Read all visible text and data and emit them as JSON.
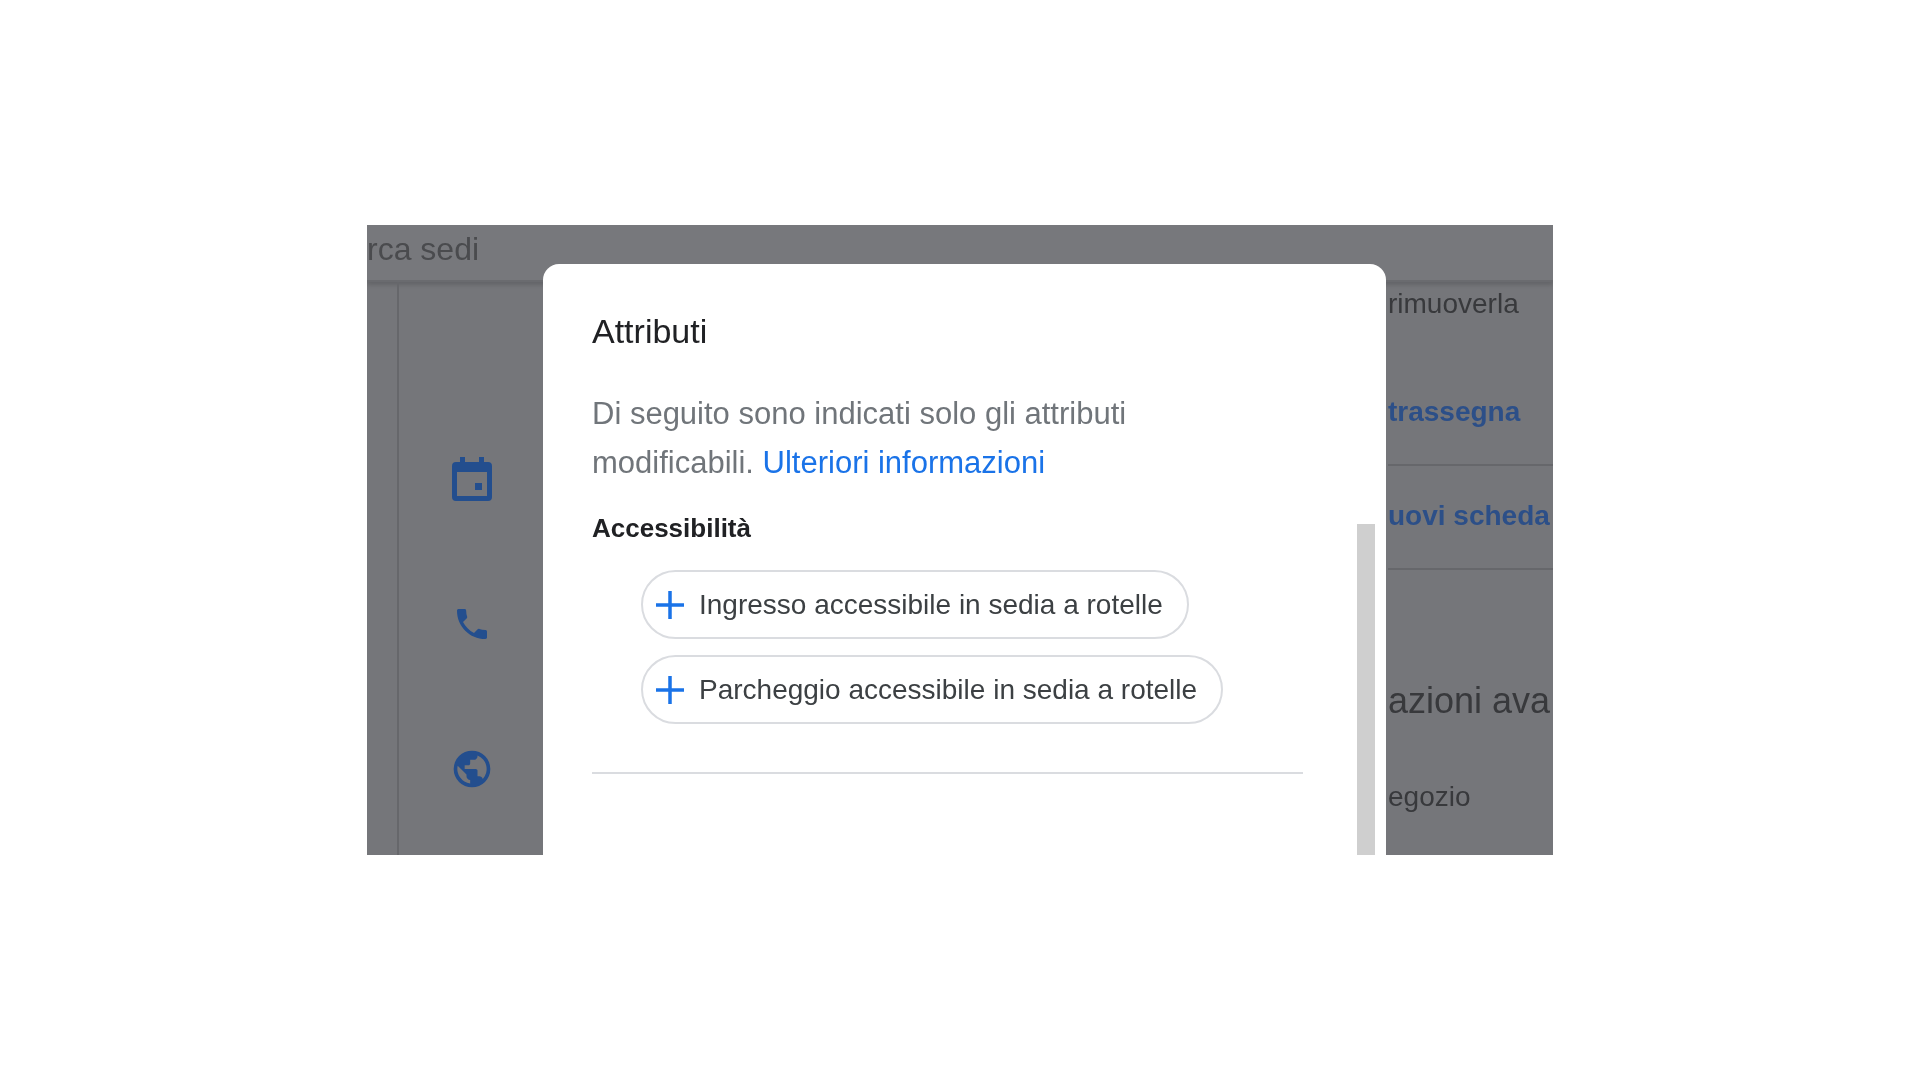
{
  "background": {
    "search_text": "rca sedi",
    "fragments": [
      {
        "text": "rimuoverla",
        "kind": "text"
      },
      {
        "text": "trassegna",
        "kind": "link"
      },
      {
        "text": "uovi scheda",
        "kind": "link"
      },
      {
        "text": "azioni ava",
        "kind": "heading"
      },
      {
        "text": "egozio",
        "kind": "text"
      }
    ]
  },
  "dialog": {
    "title": "Attributi",
    "description": "Di seguito sono indicati solo gli attributi modificabili.",
    "link": "Ulteriori informazioni",
    "section": "Accessibilità",
    "attributes": [
      {
        "label": "Ingresso accessibile in sedia a rotelle"
      },
      {
        "label": "Parcheggio accessibile in sedia a rotelle"
      }
    ]
  }
}
